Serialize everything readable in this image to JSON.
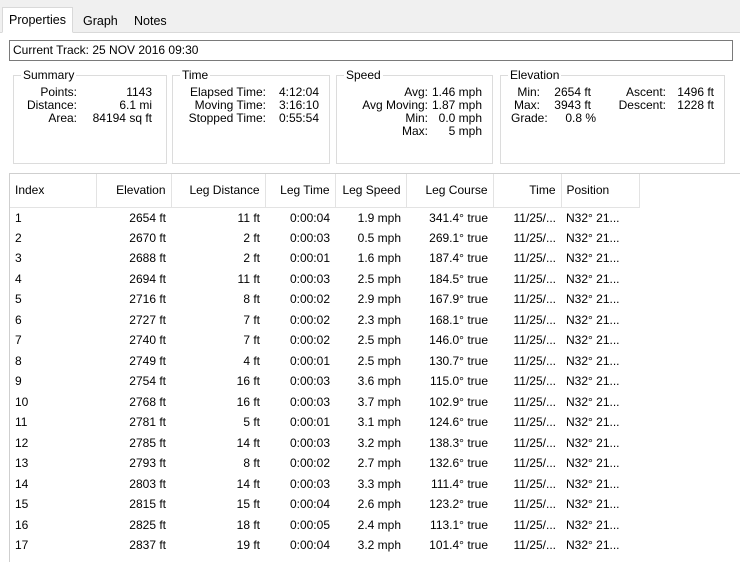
{
  "tabs": [
    {
      "label": "Properties"
    },
    {
      "label": "Graph"
    },
    {
      "label": "Notes"
    }
  ],
  "track": "Current Track: 25 NOV 2016 09:30",
  "summary": {
    "title": "Summary",
    "points_label": "Points:",
    "points_value": "1143",
    "distance_label": "Distance:",
    "distance_value": "6.1 mi",
    "area_label": "Area:",
    "area_value": "84194 sq ft"
  },
  "time": {
    "title": "Time",
    "elapsed_label": "Elapsed Time:",
    "elapsed_value": "4:12:04",
    "moving_label": "Moving Time:",
    "moving_value": "3:16:10",
    "stopped_label": "Stopped Time:",
    "stopped_value": "0:55:54"
  },
  "speed": {
    "title": "Speed",
    "avg_label": "Avg:",
    "avg_value": "1.46 mph",
    "avgmoving_label": "Avg Moving:",
    "avgmoving_value": "1.87 mph",
    "min_label": "Min:",
    "min_value": "0.0 mph",
    "max_label": "Max:",
    "max_value": "5 mph"
  },
  "elevation": {
    "title": "Elevation",
    "min_label": "Min:",
    "min_value": "2654 ft",
    "max_label": "Max:",
    "max_value": "3943 ft",
    "ascent_label": "Ascent:",
    "ascent_value": "1496 ft",
    "descent_label": "Descent:",
    "descent_value": "1228 ft",
    "grade_label": "Grade:",
    "grade_value": "0.8 %"
  },
  "table": {
    "columns": [
      "Index",
      "Elevation",
      "Leg Distance",
      "Leg Time",
      "Leg Speed",
      "Leg Course",
      "Time",
      "Position"
    ],
    "rows": [
      [
        "1",
        "2654 ft",
        "11 ft",
        "0:00:04",
        "1.9 mph",
        "341.4° true",
        "11/25/...",
        "N32° 21..."
      ],
      [
        "2",
        "2670 ft",
        "2 ft",
        "0:00:03",
        "0.5 mph",
        "269.1° true",
        "11/25/...",
        "N32° 21..."
      ],
      [
        "3",
        "2688 ft",
        "2 ft",
        "0:00:01",
        "1.6 mph",
        "187.4° true",
        "11/25/...",
        "N32° 21..."
      ],
      [
        "4",
        "2694 ft",
        "11 ft",
        "0:00:03",
        "2.5 mph",
        "184.5° true",
        "11/25/...",
        "N32° 21..."
      ],
      [
        "5",
        "2716 ft",
        "8 ft",
        "0:00:02",
        "2.9 mph",
        "167.9° true",
        "11/25/...",
        "N32° 21..."
      ],
      [
        "6",
        "2727 ft",
        "7 ft",
        "0:00:02",
        "2.3 mph",
        "168.1° true",
        "11/25/...",
        "N32° 21..."
      ],
      [
        "7",
        "2740 ft",
        "7 ft",
        "0:00:02",
        "2.5 mph",
        "146.0° true",
        "11/25/...",
        "N32° 21..."
      ],
      [
        "8",
        "2749 ft",
        "4 ft",
        "0:00:01",
        "2.5 mph",
        "130.7° true",
        "11/25/...",
        "N32° 21..."
      ],
      [
        "9",
        "2754 ft",
        "16 ft",
        "0:00:03",
        "3.6 mph",
        "115.0° true",
        "11/25/...",
        "N32° 21..."
      ],
      [
        "10",
        "2768 ft",
        "16 ft",
        "0:00:03",
        "3.7 mph",
        "102.9° true",
        "11/25/...",
        "N32° 21..."
      ],
      [
        "11",
        "2781 ft",
        "5 ft",
        "0:00:01",
        "3.1 mph",
        "124.6° true",
        "11/25/...",
        "N32° 21..."
      ],
      [
        "12",
        "2785 ft",
        "14 ft",
        "0:00:03",
        "3.2 mph",
        "138.3° true",
        "11/25/...",
        "N32° 21..."
      ],
      [
        "13",
        "2793 ft",
        "8 ft",
        "0:00:02",
        "2.7 mph",
        "132.6° true",
        "11/25/...",
        "N32° 21..."
      ],
      [
        "14",
        "2803 ft",
        "14 ft",
        "0:00:03",
        "3.3 mph",
        "111.4° true",
        "11/25/...",
        "N32° 21..."
      ],
      [
        "15",
        "2815 ft",
        "15 ft",
        "0:00:04",
        "2.6 mph",
        "123.2° true",
        "11/25/...",
        "N32° 21..."
      ],
      [
        "16",
        "2825 ft",
        "18 ft",
        "0:00:05",
        "2.4 mph",
        "113.1° true",
        "11/25/...",
        "N32° 21..."
      ],
      [
        "17",
        "2837 ft",
        "19 ft",
        "0:00:04",
        "3.2 mph",
        "101.4° true",
        "11/25/...",
        "N32° 21..."
      ]
    ]
  }
}
